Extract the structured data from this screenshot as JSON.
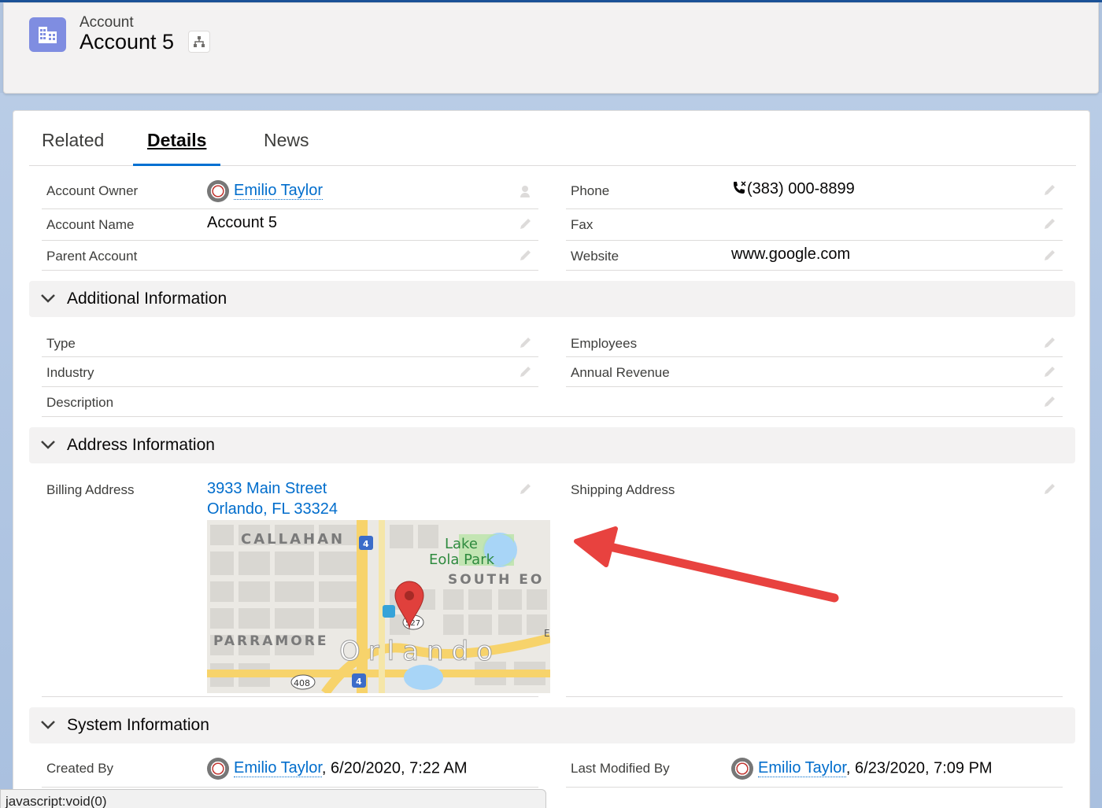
{
  "header": {
    "object_type": "Account",
    "record_name": "Account 5"
  },
  "tabs": [
    {
      "label": "Related",
      "active": false
    },
    {
      "label": "Details",
      "active": true
    },
    {
      "label": "News",
      "active": false
    }
  ],
  "fields": {
    "account_owner": {
      "label": "Account Owner",
      "value": "Emilio Taylor"
    },
    "account_name": {
      "label": "Account Name",
      "value": "Account 5"
    },
    "parent_account": {
      "label": "Parent Account",
      "value": ""
    },
    "phone": {
      "label": "Phone",
      "value": "(383) 000-8899"
    },
    "fax": {
      "label": "Fax",
      "value": ""
    },
    "website": {
      "label": "Website",
      "value": "www.google.com"
    }
  },
  "sections": {
    "additional": {
      "title": "Additional Information",
      "type": {
        "label": "Type"
      },
      "industry": {
        "label": "Industry"
      },
      "description": {
        "label": "Description"
      },
      "employees": {
        "label": "Employees"
      },
      "annual_revenue": {
        "label": "Annual Revenue"
      }
    },
    "address": {
      "title": "Address Information",
      "billing": {
        "label": "Billing Address",
        "line1": "3933 Main Street",
        "line2": "Orlando, FL 33324"
      },
      "shipping": {
        "label": "Shipping Address"
      }
    },
    "system": {
      "title": "System Information",
      "created_by": {
        "label": "Created By",
        "user": "Emilio Taylor",
        "date": ", 6/20/2020, 7:22 AM"
      },
      "last_modified_by": {
        "label": "Last Modified By",
        "user": "Emilio Taylor",
        "date": ", 6/23/2020, 7:09 PM"
      }
    }
  },
  "map": {
    "labels": {
      "callahan": "CALLAHAN",
      "lake": "Lake",
      "eola_park": "Eola Park",
      "south_eo": "SOUTH EO",
      "parramore": "PARRAMORE",
      "orlando": "Orlando",
      "route_4a": "4",
      "route_4b": "4",
      "route_408": "408",
      "route_527": "527",
      "edge_e": "E"
    }
  },
  "annotation": {
    "arrow_color": "#e8423f"
  },
  "statusbar": {
    "text": "javascript:void(0)"
  },
  "colors": {
    "link": "#006dcc",
    "accent": "#0070d2",
    "object_icon": "#7f8de1"
  }
}
